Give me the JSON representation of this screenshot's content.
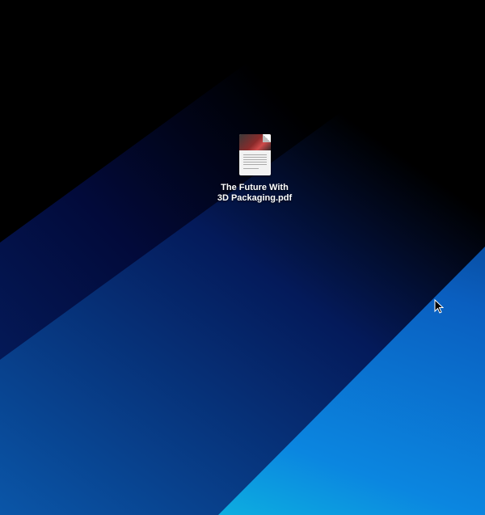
{
  "desktop": {
    "files": [
      {
        "name_line1": "The Future With",
        "name_line2": "3D Packaging.pdf",
        "icon": "pdf-thumbnail-icon"
      }
    ],
    "cursor": "arrow-cursor-icon"
  }
}
